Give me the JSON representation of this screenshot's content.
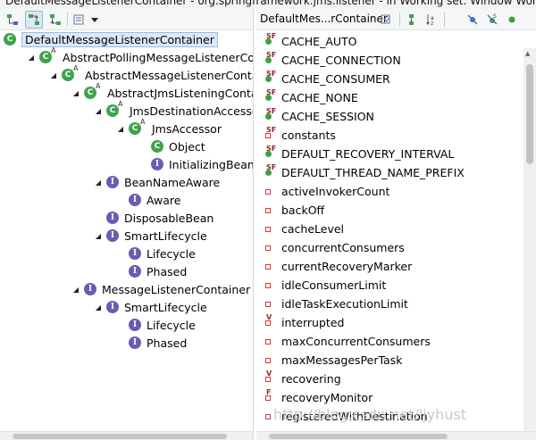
{
  "window": {
    "title": "DefaultMessageListenerContainer - org.springframework.jms.listener - in Working set: Window Work"
  },
  "hierarchy": {
    "toolbar_icons": [
      "type-hierarchy-icon",
      "supertype-hierarchy-icon",
      "subtype-hierarchy-icon",
      "layout-menu-icon",
      "view-menu-icon"
    ],
    "nodes": [
      {
        "label": "DefaultMessageListenerContainer",
        "kind": "class",
        "mod": "",
        "depth": 0,
        "twisty": "",
        "selected": true
      },
      {
        "label": "AbstractPollingMessageListenerContair",
        "kind": "class",
        "mod": "A",
        "depth": 1,
        "twisty": "▲",
        "selected": false
      },
      {
        "label": "AbstractMessageListenerContainer",
        "kind": "class",
        "mod": "A",
        "depth": 2,
        "twisty": "▲",
        "selected": false
      },
      {
        "label": "AbstractJmsListeningContainer",
        "kind": "class",
        "mod": "A",
        "depth": 3,
        "twisty": "▲",
        "selected": false
      },
      {
        "label": "JmsDestinationAccessor",
        "kind": "class",
        "mod": "A",
        "depth": 4,
        "twisty": "▲",
        "selected": false
      },
      {
        "label": "JmsAccessor",
        "kind": "class",
        "mod": "A",
        "depth": 5,
        "twisty": "▲",
        "selected": false
      },
      {
        "label": "Object",
        "kind": "class",
        "mod": "",
        "depth": 6,
        "twisty": "",
        "selected": false
      },
      {
        "label": "InitializingBean",
        "kind": "interface",
        "mod": "",
        "depth": 6,
        "twisty": "",
        "selected": false
      },
      {
        "label": "BeanNameAware",
        "kind": "interface",
        "mod": "",
        "depth": 4,
        "twisty": "▲",
        "selected": false
      },
      {
        "label": "Aware",
        "kind": "interface",
        "mod": "",
        "depth": 5,
        "twisty": "",
        "selected": false
      },
      {
        "label": "DisposableBean",
        "kind": "interface",
        "mod": "",
        "depth": 4,
        "twisty": "",
        "selected": false
      },
      {
        "label": "SmartLifecycle",
        "kind": "interface",
        "mod": "",
        "depth": 4,
        "twisty": "▲",
        "selected": false
      },
      {
        "label": "Lifecycle",
        "kind": "interface",
        "mod": "",
        "depth": 5,
        "twisty": "",
        "selected": false
      },
      {
        "label": "Phased",
        "kind": "interface",
        "mod": "",
        "depth": 5,
        "twisty": "",
        "selected": false
      },
      {
        "label": "MessageListenerContainer",
        "kind": "interface",
        "mod": "",
        "depth": 3,
        "twisty": "▲",
        "selected": false
      },
      {
        "label": "SmartLifecycle",
        "kind": "interface",
        "mod": "",
        "depth": 4,
        "twisty": "▲",
        "selected": false
      },
      {
        "label": "Lifecycle",
        "kind": "interface",
        "mod": "",
        "depth": 5,
        "twisty": "",
        "selected": false
      },
      {
        "label": "Phased",
        "kind": "interface",
        "mod": "",
        "depth": 5,
        "twisty": "",
        "selected": false
      }
    ]
  },
  "members": {
    "title": "DefaultMes...rContainer",
    "toolbar_icons": [
      "lock-view-icon",
      "show-inherited-members-icon",
      "sort-members-icon",
      "hide-fields-icon",
      "hide-static-icon",
      "hide-non-public-icon"
    ],
    "items": [
      {
        "label": "CACHE_AUTO",
        "kind": "public",
        "mod": "SF"
      },
      {
        "label": "CACHE_CONNECTION",
        "kind": "public",
        "mod": "SF"
      },
      {
        "label": "CACHE_CONSUMER",
        "kind": "public",
        "mod": "SF"
      },
      {
        "label": "CACHE_NONE",
        "kind": "public",
        "mod": "SF"
      },
      {
        "label": "CACHE_SESSION",
        "kind": "public",
        "mod": "SF"
      },
      {
        "label": "constants",
        "kind": "private",
        "mod": "SF"
      },
      {
        "label": "DEFAULT_RECOVERY_INTERVAL",
        "kind": "public",
        "mod": "SF"
      },
      {
        "label": "DEFAULT_THREAD_NAME_PREFIX",
        "kind": "public",
        "mod": "SF"
      },
      {
        "label": "activeInvokerCount",
        "kind": "private",
        "mod": ""
      },
      {
        "label": "backOff",
        "kind": "private",
        "mod": ""
      },
      {
        "label": "cacheLevel",
        "kind": "private",
        "mod": ""
      },
      {
        "label": "concurrentConsumers",
        "kind": "private",
        "mod": ""
      },
      {
        "label": "currentRecoveryMarker",
        "kind": "private",
        "mod": ""
      },
      {
        "label": "idleConsumerLimit",
        "kind": "private",
        "mod": ""
      },
      {
        "label": "idleTaskExecutionLimit",
        "kind": "private",
        "mod": ""
      },
      {
        "label": "interrupted",
        "kind": "private",
        "mod": "V"
      },
      {
        "label": "maxConcurrentConsumers",
        "kind": "private",
        "mod": ""
      },
      {
        "label": "maxMessagesPerTask",
        "kind": "private",
        "mod": ""
      },
      {
        "label": "recovering",
        "kind": "private",
        "mod": "V"
      },
      {
        "label": "recoveryMonitor",
        "kind": "private",
        "mod": "F"
      },
      {
        "label": "registeredWithDestination",
        "kind": "private",
        "mod": ""
      }
    ]
  },
  "watermark": "http://blog.csdn.net/ljyhust",
  "colors": {
    "class_icon": "#3fa34d",
    "interface_icon": "#6a5bb5",
    "private_field": "#d6373a",
    "public_field": "#3aa142",
    "selection": "#dae8fa"
  }
}
